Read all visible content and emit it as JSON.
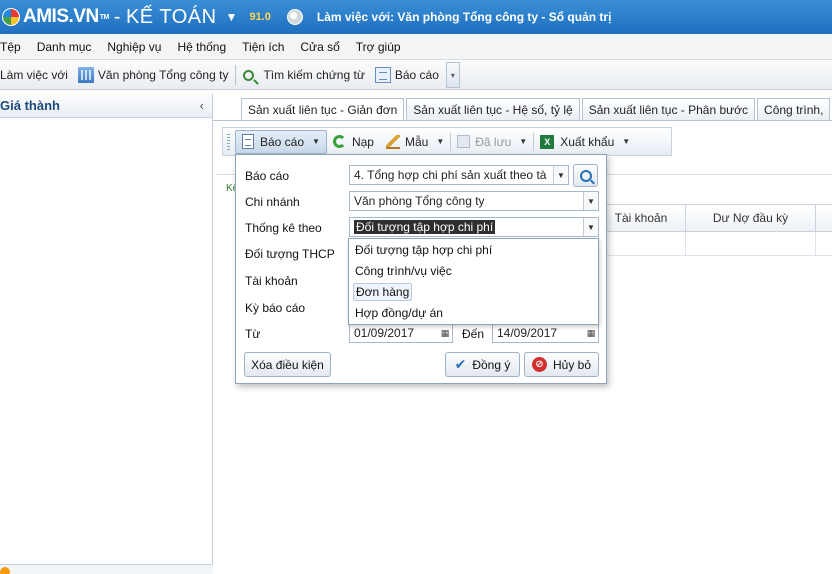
{
  "app": {
    "brand": "AMIS.VN",
    "trademark": "TM",
    "separator": "-",
    "product": "KẾ TOÁN",
    "version": "91.0",
    "working_with": "Làm việc với: Văn phòng Tổng công ty - Sổ quản trị"
  },
  "menu": [
    "Tệp",
    "Danh mục",
    "Nghiệp vụ",
    "Hệ thống",
    "Tiện ích",
    "Cửa sổ",
    "Trợ giúp"
  ],
  "toolbar": {
    "work_with_label": "Làm việc với",
    "branch_label": "Văn phòng Tổng công ty",
    "search_voucher_label": "Tìm kiếm chứng từ",
    "report_label": "Báo cáo"
  },
  "left_panel": {
    "title": "Giá thành",
    "collapse": "‹"
  },
  "tabs": [
    "Sản xuất liên tục - Giản đơn",
    "Sản xuất liên tục - Hệ số, tỷ lệ",
    "Sản xuất liên tục - Phân bước",
    "Công trình,"
  ],
  "report_toolbar": {
    "report": "Báo cáo",
    "refresh": "Nạp",
    "template": "Mẫu",
    "saved": "Đã lưu",
    "export": "Xuất khẩu"
  },
  "grid": {
    "left_label": "Kế",
    "columns": [
      "Tài khoản",
      "Dư Nợ đầu kỳ"
    ]
  },
  "dialog": {
    "report_label": "Báo cáo",
    "report_value": "4. Tổng hợp chi phí sản xuất theo tà",
    "branch_label": "Chi nhánh",
    "branch_value": "Văn phòng Tổng công ty",
    "group_by_label": "Thống kê theo",
    "group_by_value": "Đối tượng tập hợp chi phí",
    "cost_object_label": "Đối tượng THCP",
    "account_label": "Tài khoản",
    "period_label": "Kỳ báo cáo",
    "from_label": "Từ",
    "from_value": "01/09/2017",
    "to_label": "Đến",
    "to_value": "14/09/2017",
    "clear_button": "Xóa điều kiện",
    "ok_button": "Đồng ý",
    "cancel_button": "Hủy bỏ"
  },
  "dropdown": {
    "options": [
      "Đối tượng tập hợp chi phí",
      "Công trình/vụ việc",
      "Đơn hàng",
      "Hợp đồng/dự án"
    ]
  },
  "colors": {
    "title_bar": "#1f6fbf",
    "version": "#ffd54f",
    "selection": "#2f2f2f"
  }
}
